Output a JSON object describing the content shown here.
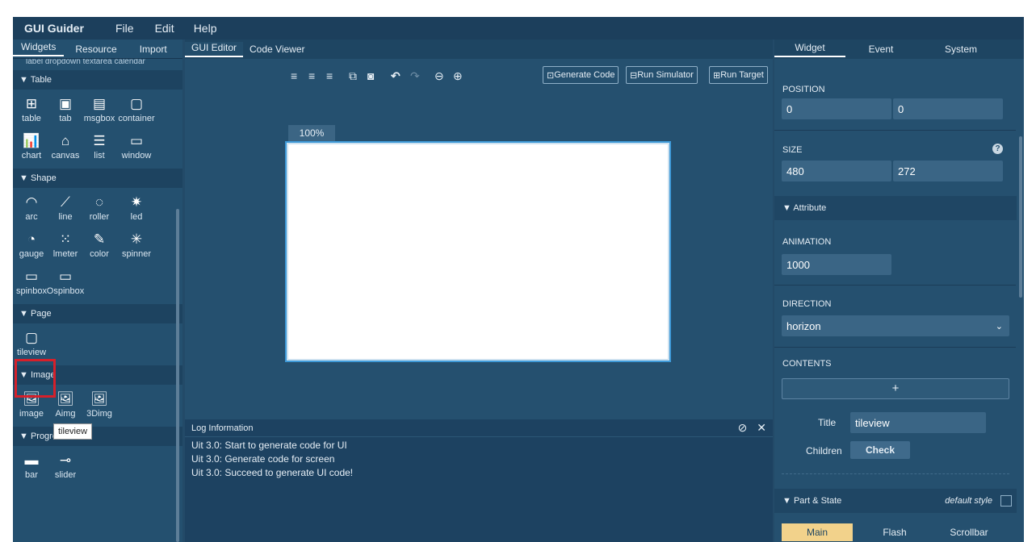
{
  "menubar": {
    "brand": "GUI Guider",
    "items": [
      "File",
      "Edit",
      "Help"
    ]
  },
  "left": {
    "tabs": [
      "Widgets",
      "Resource",
      "Import"
    ],
    "cut_row": "label   dropdown  textarea  calendar",
    "sections": [
      {
        "title": "▼ Table",
        "widgets": [
          {
            "label": "table",
            "icon": "table-icon",
            "glyph": "⊞"
          },
          {
            "label": "tab",
            "icon": "tab-icon",
            "glyph": "▣"
          },
          {
            "label": "msgbox",
            "icon": "msgbox-icon",
            "glyph": "▤"
          },
          {
            "label": "container",
            "icon": "container-icon",
            "glyph": "▢"
          },
          {
            "label": "chart",
            "icon": "chart-icon",
            "glyph": "📊"
          },
          {
            "label": "canvas",
            "icon": "canvas-icon",
            "glyph": "⌂"
          },
          {
            "label": "list",
            "icon": "list-icon",
            "glyph": "☰"
          },
          {
            "label": "window",
            "icon": "window-icon",
            "glyph": "▭"
          }
        ]
      },
      {
        "title": "▼ Shape",
        "widgets": [
          {
            "label": "arc",
            "icon": "arc-icon",
            "glyph": "◠"
          },
          {
            "label": "line",
            "icon": "line-icon",
            "glyph": "⟋"
          },
          {
            "label": "roller",
            "icon": "roller-icon",
            "glyph": "◌"
          },
          {
            "label": "led",
            "icon": "led-icon",
            "glyph": "✷"
          },
          {
            "label": "gauge",
            "icon": "gauge-icon",
            "glyph": "◔"
          },
          {
            "label": "lmeter",
            "icon": "lmeter-icon",
            "glyph": "⁙"
          },
          {
            "label": "color",
            "icon": "color-icon",
            "glyph": "✎"
          },
          {
            "label": "spinner",
            "icon": "spinner-icon",
            "glyph": "✳"
          },
          {
            "label": "spinbox",
            "icon": "spinbox-icon",
            "glyph": "▭"
          },
          {
            "label": "Ospinbox",
            "icon": "ospinbox-icon",
            "glyph": "▭"
          }
        ]
      },
      {
        "title": "▼ Page",
        "widgets": [
          {
            "label": "tileview",
            "icon": "tileview-icon",
            "glyph": "▢"
          }
        ]
      },
      {
        "title": "▼ Image",
        "widgets": [
          {
            "label": "image",
            "icon": "image-icon",
            "glyph": "🖼"
          },
          {
            "label": "Aimg",
            "icon": "aimg-icon",
            "glyph": "🖼"
          },
          {
            "label": "3Dimg",
            "icon": "3dimg-icon",
            "glyph": "🖼"
          }
        ]
      },
      {
        "title": "▼ Progress",
        "widgets": [
          {
            "label": "bar",
            "icon": "bar-icon",
            "glyph": "▬"
          },
          {
            "label": "slider",
            "icon": "slider-icon",
            "glyph": "⊸"
          }
        ]
      }
    ],
    "tooltip": "tileview"
  },
  "center": {
    "tabs": [
      "GUI Editor",
      "Code Viewer"
    ],
    "toolbar": {
      "icons": [
        "align-left-icon",
        "align-center-icon",
        "align-right-icon",
        "bring-forward-icon",
        "send-backward-icon",
        "undo-icon",
        "redo-icon",
        "zoom-out-icon",
        "zoom-in-icon"
      ],
      "generate_code": "Generate Code",
      "run_simulator": "Run Simulator",
      "run_target": "Run Target"
    },
    "zoom": "100%",
    "log": {
      "title": "Log Information",
      "lines": [
        "Uit 3.0: Start to generate code for UI",
        "Uit 3.0: Generate code for screen",
        "Uit 3.0: Succeed to generate UI code!"
      ]
    }
  },
  "right": {
    "tabs": [
      "Widget",
      "Event",
      "System"
    ],
    "position": {
      "label": "POSITION",
      "x": "0",
      "y": "0"
    },
    "size": {
      "label": "SIZE",
      "w": "480",
      "h": "272"
    },
    "attribute": "▼ Attribute",
    "animation": {
      "label": "ANIMATION",
      "value": "1000"
    },
    "direction": {
      "label": "DIRECTION",
      "value": "horizon"
    },
    "contents": {
      "label": "CONTENTS",
      "add": "+",
      "title_label": "Title",
      "title_value": "tileview",
      "children_label": "Children",
      "check_label": "Check"
    },
    "part_state": {
      "label": "▼ Part & State",
      "default_style": "default style",
      "tabs": [
        "Main",
        "Flash",
        "Scrollbar"
      ]
    }
  }
}
